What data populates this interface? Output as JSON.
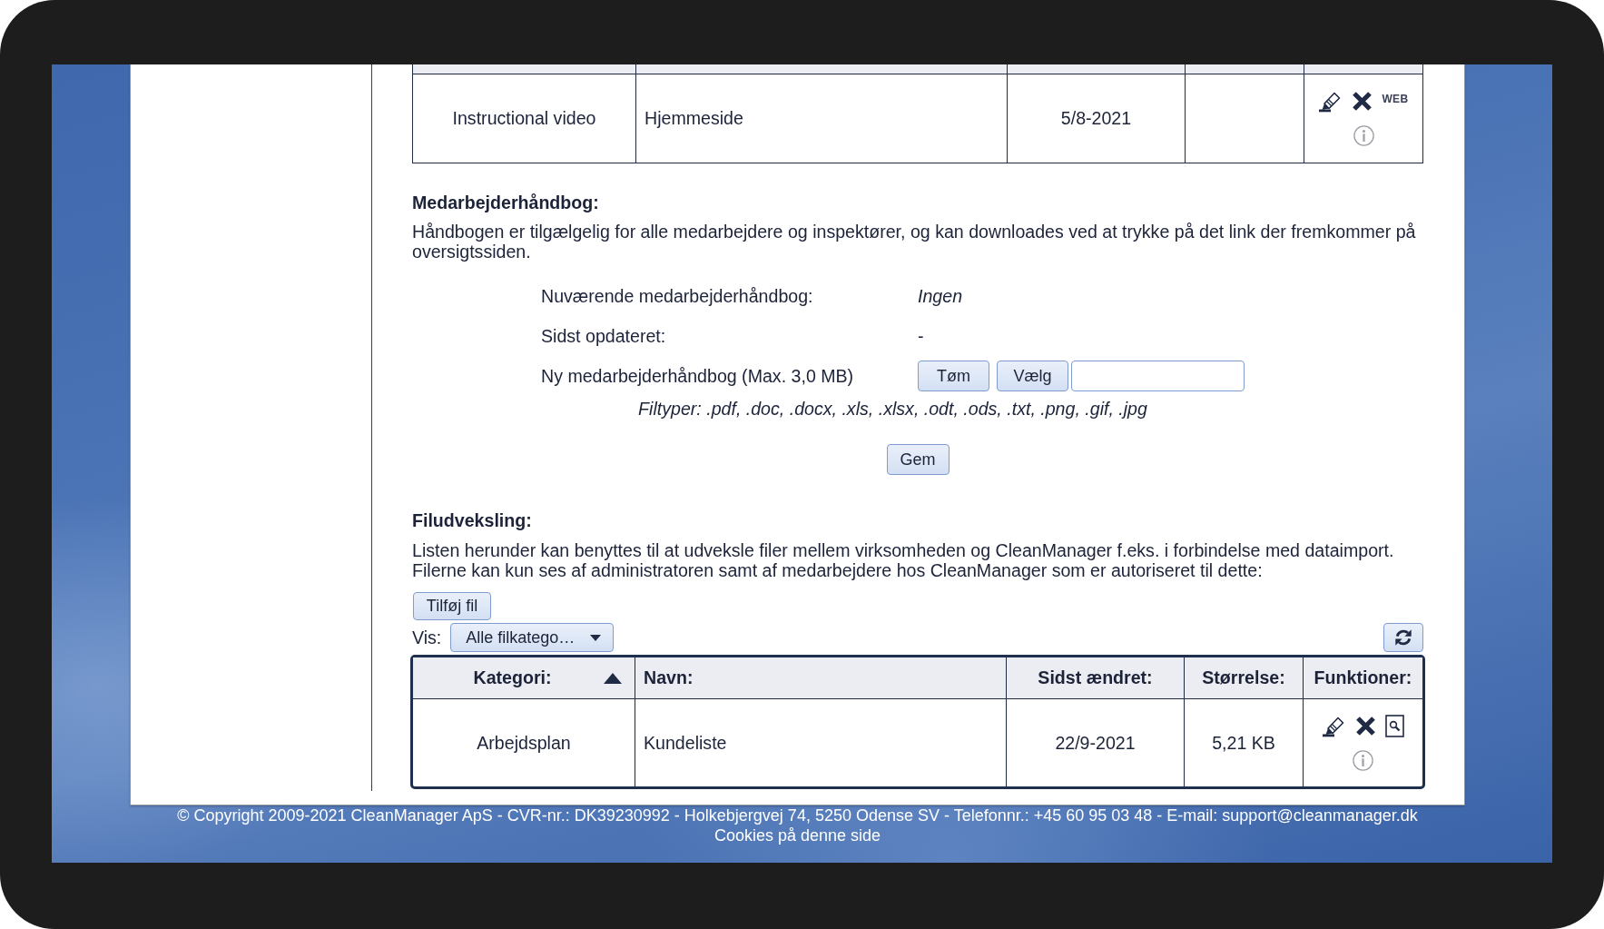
{
  "top_table": {
    "rows": [
      {
        "category": "Instructional video",
        "name": "Hjemmeside",
        "modified": "5/8-2021",
        "functions": [
          {
            "kind": "edit"
          },
          {
            "kind": "delete"
          },
          {
            "kind": "web",
            "label": "WEB"
          },
          {
            "kind": "info"
          }
        ]
      }
    ]
  },
  "handbook": {
    "heading": "Medarbejderhåndbog:",
    "description": "Håndbogen er tilgælgelig for alle medarbejdere og inspektører, og kan downloades ved at trykke på det link der fremkommer på oversigtssiden.",
    "fields": [
      {
        "kind": "current_file",
        "label": "Nuværende medarbejderhåndbog:",
        "value": "Ingen"
      },
      {
        "kind": "date",
        "label": "Sidst opdateret:",
        "value": "-"
      },
      {
        "kind": "file",
        "label": "Ny medarbejderhåndbog (Max. 3,0 MB)",
        "buttons": [
          "Tøm",
          "Vælg"
        ]
      }
    ],
    "file_types": "Filtyper: .pdf, .doc, .docx, .xls, .xlsx, .odt, .ods, .txt, .png, .gif, .jpg",
    "save_button": "Gem"
  },
  "file_exchange": {
    "heading": "Filudveksling:",
    "description": "Listen herunder kan benyttes til at udveksle filer mellem virksomheden og CleanManager f.eks. i forbindelse med dataimport.\nFilerne kan kun ses af administratoren samt af medarbejdere hos CleanManager som er autoriseret til dette:",
    "add_button": "Tilføj fil",
    "filter": {
      "label": "Vis:",
      "value": "Alle filkatego…"
    },
    "table": {
      "columns": [
        {
          "label": "Kategori:",
          "sorted_ascending": true
        },
        {
          "label": "Navn:",
          "sorted_ascending": false
        },
        {
          "label": "Sidst ændret:",
          "sorted_ascending": false
        },
        {
          "label": "Størrelse:",
          "sorted_ascending": false
        },
        {
          "label": "Funktioner:",
          "sorted_ascending": false
        }
      ],
      "rows": [
        {
          "category": "Arbejdsplan",
          "name": "Kundeliste",
          "modified": "22/9-2021",
          "size": "5,21 KB",
          "functions": [
            {
              "kind": "edit"
            },
            {
              "kind": "delete"
            },
            {
              "kind": "preview"
            },
            {
              "kind": "info"
            }
          ]
        }
      ]
    }
  },
  "footer": {
    "text": "© Copyright 2009-2021 CleanManager ApS - CVR-nr.: DK39230992 - Holkebjergvej 74, 5250 Odense SV - Telefonnr.: +45 60 95 03 48 - E-mail: support@cleanmanager.dk",
    "link": "Cookies på denne side"
  }
}
